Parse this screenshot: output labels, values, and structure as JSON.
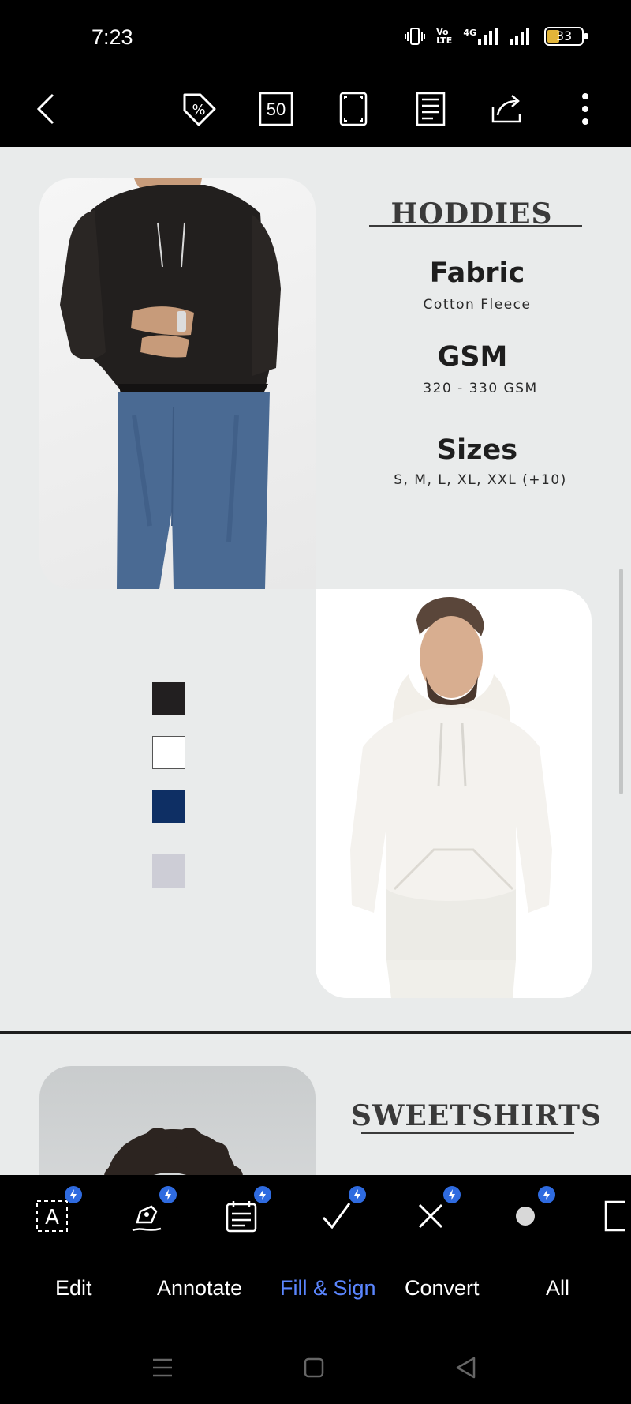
{
  "status_bar": {
    "time": "7:23",
    "network_label": "4G",
    "volte_label_top": "Vo",
    "volte_label_bottom": "LTE",
    "battery_level": "33"
  },
  "toolbar": {
    "icons": [
      "back-icon",
      "discount-tag-icon",
      "page-count-icon",
      "fullscreen-icon",
      "reader-mode-icon",
      "share-icon",
      "more-icon"
    ],
    "page_count_label": "50"
  },
  "document": {
    "page1": {
      "heading": "HODDIES",
      "specs": [
        {
          "title": "Fabric",
          "value": "Cotton Fleece"
        },
        {
          "title": "GSM",
          "value": "320 - 330 GSM"
        },
        {
          "title": "Sizes",
          "value": "S, M, L, XL, XXL (+10)"
        }
      ],
      "color_swatches": [
        "#221f20",
        "#ffffff",
        "#0e2f64",
        "#cdcdd6"
      ]
    },
    "page2": {
      "heading": "SWEETSHIRTS"
    }
  },
  "tools": {
    "items": [
      "edit-text-tool-icon",
      "annotate-pen-tool-icon",
      "fill-form-tool-icon",
      "checkmark-tool-icon",
      "cross-tool-icon",
      "dot-tool-icon"
    ],
    "accent": "#2f6be0"
  },
  "tabs": {
    "items": [
      {
        "label": "Edit"
      },
      {
        "label": "Annotate"
      },
      {
        "label": "Fill & Sign"
      },
      {
        "label": "Convert"
      },
      {
        "label": "All"
      }
    ],
    "active_index": 2,
    "active_color": "#5b86ff"
  },
  "nav": {
    "icons": [
      "recent-apps-icon",
      "home-icon",
      "back-nav-icon"
    ]
  }
}
